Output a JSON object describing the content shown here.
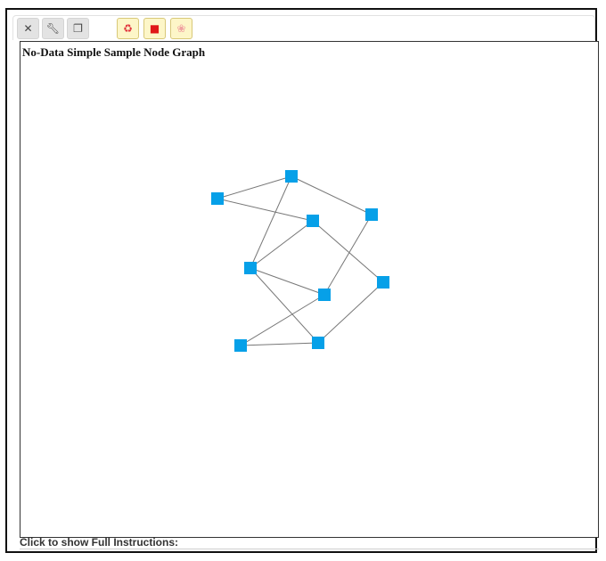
{
  "toolbar": {
    "buttons": [
      {
        "name": "close-icon",
        "glyph": "✕",
        "color": "#444444",
        "style": "grey"
      },
      {
        "name": "wrench-icon",
        "glyph": "🔧︎",
        "color": "#444444",
        "style": "grey"
      },
      {
        "name": "copy-icon",
        "glyph": "❐",
        "color": "#444444",
        "style": "grey"
      },
      {
        "name": "recycle-icon",
        "glyph": "♻",
        "color": "#e0303a",
        "style": "yellow"
      },
      {
        "name": "stop-icon",
        "glyph": "■",
        "color": "#e01818",
        "style": "yellow"
      },
      {
        "name": "flower-icon",
        "glyph": "❀",
        "color": "#f0a0a0",
        "style": "yellow"
      }
    ]
  },
  "graph": {
    "title": "No-Data Simple Sample Node Graph",
    "node_color": "#06a0e8",
    "edge_color": "#777777",
    "nodes": [
      "n1",
      "n2",
      "n3",
      "n4",
      "n5",
      "n6",
      "n7",
      "n8",
      "n9",
      "n10"
    ],
    "edges": [
      [
        "n1",
        "n2"
      ],
      [
        "n1",
        "n3"
      ],
      [
        "n2",
        "n4"
      ],
      [
        "n2",
        "n5"
      ],
      [
        "n3",
        "n5"
      ],
      [
        "n3",
        "n6"
      ],
      [
        "n4",
        "n7"
      ],
      [
        "n5",
        "n8"
      ],
      [
        "n5",
        "n7"
      ],
      [
        "n7",
        "n9"
      ],
      [
        "n6",
        "n10"
      ],
      [
        "n8",
        "n10"
      ],
      [
        "n9",
        "n8"
      ]
    ]
  },
  "footer": {
    "instructions": "Click to show Full Instructions:"
  }
}
